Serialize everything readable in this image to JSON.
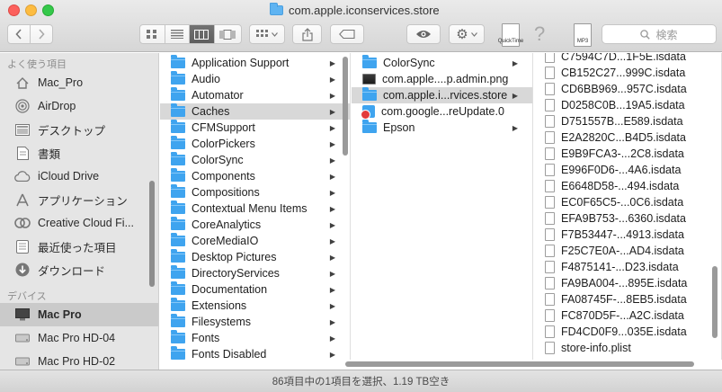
{
  "window": {
    "title": "com.apple.iconservices.store"
  },
  "toolbar": {
    "back_icon": "chevron-left-icon",
    "forward_icon": "chevron-right-icon",
    "view_modes": [
      "icon-view",
      "list-view",
      "column-view",
      "cover-flow-view"
    ],
    "active_view": "column-view",
    "search_placeholder": "検索",
    "doc_label_1": "QuickTime",
    "doc_label_2": "MP3"
  },
  "sidebar": {
    "favorites_header": "よく使う項目",
    "favorites": [
      {
        "label": "Mac_Pro",
        "icon": "home-icon"
      },
      {
        "label": "AirDrop",
        "icon": "airdrop-icon"
      },
      {
        "label": "デスクトップ",
        "icon": "desktop-icon"
      },
      {
        "label": "書類",
        "icon": "documents-icon"
      },
      {
        "label": "iCloud Drive",
        "icon": "cloud-icon"
      },
      {
        "label": "アプリケーション",
        "icon": "applications-icon"
      },
      {
        "label": "Creative Cloud Fi...",
        "icon": "creative-cloud-icon"
      },
      {
        "label": "最近使った項目",
        "icon": "recents-icon"
      },
      {
        "label": "ダウンロード",
        "icon": "downloads-icon"
      }
    ],
    "devices_header": "デバイス",
    "devices": [
      {
        "label": "Mac Pro",
        "icon": "computer-icon",
        "selected": true
      },
      {
        "label": "Mac Pro HD-04",
        "icon": "disk-icon"
      },
      {
        "label": "Mac Pro HD-02",
        "icon": "disk-icon"
      }
    ]
  },
  "column1": {
    "items": [
      {
        "label": "Application Support",
        "type": "folder"
      },
      {
        "label": "Audio",
        "type": "folder"
      },
      {
        "label": "Automator",
        "type": "folder"
      },
      {
        "label": "Caches",
        "type": "folder",
        "selected": true
      },
      {
        "label": "CFMSupport",
        "type": "folder"
      },
      {
        "label": "ColorPickers",
        "type": "folder"
      },
      {
        "label": "ColorSync",
        "type": "folder"
      },
      {
        "label": "Components",
        "type": "folder"
      },
      {
        "label": "Compositions",
        "type": "folder"
      },
      {
        "label": "Contextual Menu Items",
        "type": "folder"
      },
      {
        "label": "CoreAnalytics",
        "type": "folder"
      },
      {
        "label": "CoreMediaIO",
        "type": "folder"
      },
      {
        "label": "Desktop Pictures",
        "type": "folder"
      },
      {
        "label": "DirectoryServices",
        "type": "folder"
      },
      {
        "label": "Documentation",
        "type": "folder"
      },
      {
        "label": "Extensions",
        "type": "folder"
      },
      {
        "label": "Filesystems",
        "type": "folder"
      },
      {
        "label": "Fonts",
        "type": "folder"
      },
      {
        "label": "Fonts Disabled",
        "type": "folder"
      }
    ]
  },
  "column2": {
    "items": [
      {
        "label": "ColorSync",
        "type": "folder",
        "arrow": true
      },
      {
        "label": "com.apple....p.admin.png",
        "type": "image",
        "arrow": false
      },
      {
        "label": "com.apple.i...rvices.store",
        "type": "folder",
        "arrow": true,
        "selected": true
      },
      {
        "label": "com.google...reUpdate.0",
        "type": "blocked-folder",
        "arrow": false
      },
      {
        "label": "Epson",
        "type": "folder",
        "arrow": true
      }
    ]
  },
  "column3": {
    "items": [
      "C7594C7D...1F5E.isdata",
      "CB152C27...999C.isdata",
      "CD6BB969...957C.isdata",
      "D0258C0B...19A5.isdata",
      "D751557B...E589.isdata",
      "E2A2820C...B4D5.isdata",
      "E9B9FCA3-...2C8.isdata",
      "E996F0D6-...4A6.isdata",
      "E6648D58-...494.isdata",
      "EC0F65C5-...0C6.isdata",
      "EFA9B753-...6360.isdata",
      "F7B53447-...4913.isdata",
      "F25C7E0A-...AD4.isdata",
      "F4875141-...D23.isdata",
      "FA9BA004-...895E.isdata",
      "FA08745F-...8EB5.isdata",
      "FC870D5F-...A2C.isdata",
      "FD4CD0F9...035E.isdata",
      "store-info.plist"
    ]
  },
  "status": {
    "text": "86項目中の1項目を選択、1.19 TB空き"
  }
}
